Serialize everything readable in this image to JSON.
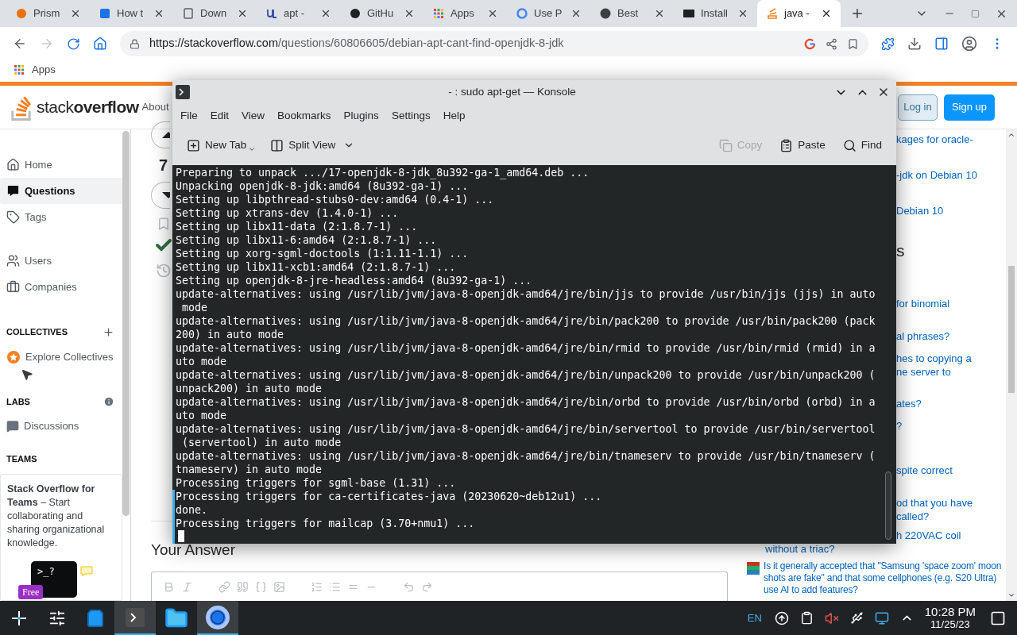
{
  "browser": {
    "tabs": [
      {
        "label": "Prism",
        "selected": false
      },
      {
        "label": "How t",
        "selected": false
      },
      {
        "label": "Down",
        "selected": false
      },
      {
        "label": "apt -",
        "selected": false
      },
      {
        "label": "GitHu",
        "selected": false
      },
      {
        "label": "Apps",
        "selected": false
      },
      {
        "label": "Use P",
        "selected": false
      },
      {
        "label": "Best",
        "selected": false
      },
      {
        "label": "Install",
        "selected": false
      },
      {
        "label": "java -",
        "selected": true
      }
    ],
    "url_host": "https://stackoverflow.com",
    "url_path": "/questions/60806605/debian-apt-cant-find-openjdk-8-jdk",
    "bookmarks": [
      "Apps"
    ]
  },
  "so": {
    "logo": "stack**overflow**",
    "nav": "About",
    "login": "Log in",
    "signup": "Sign up",
    "sidebar": {
      "sections": [
        {
          "items": [
            {
              "label": "Home",
              "selected": false
            },
            {
              "label": "Questions",
              "selected": true
            },
            {
              "label": "Tags",
              "selected": false
            }
          ]
        },
        {
          "items": [
            {
              "label": "Users",
              "selected": false
            },
            {
              "label": "Companies",
              "selected": false
            }
          ]
        }
      ],
      "collectives": {
        "heading": "COLLECTIVES",
        "item": "Explore Collectives"
      },
      "labs": {
        "heading": "LABS",
        "item": "Discussions"
      },
      "teams": {
        "heading": "TEAMS",
        "text": "**Stack Overflow for Teams** – Start collaborating and sharing organizational knowledge.",
        "glyph": ">_?",
        "badge": "Free"
      }
    },
    "main": {
      "vote_count": "7",
      "answer_heading": "Your Answer"
    },
    "right": {
      "items": [
        {
          "kind": "link",
          "lines": [
            "kages for oracle-"
          ]
        },
        {
          "kind": "link",
          "lines": [
            "-jdk on Debian 10"
          ]
        },
        {
          "kind": "link",
          "lines": [
            "Debian 10"
          ]
        },
        {
          "kind": "heading",
          "lines": [
            "s"
          ]
        },
        {
          "kind": "link",
          "lines": [
            "for binomial"
          ]
        },
        {
          "kind": "link",
          "lines": [
            "al phrases?"
          ]
        },
        {
          "kind": "link",
          "lines": [
            "hes to copying a",
            "ne server to"
          ]
        },
        {
          "kind": "link",
          "lines": [
            "ates?"
          ]
        },
        {
          "kind": "link",
          "lines": [
            "?"
          ]
        },
        {
          "kind": "link",
          "lines": [
            "spite correct"
          ]
        },
        {
          "kind": "link",
          "lines": [
            "od that you have",
            "called?"
          ]
        },
        {
          "kind": "link",
          "lines": [
            "h 220VAC coil"
          ]
        }
      ],
      "below": [
        {
          "kind": "link",
          "text": "without a triac?"
        },
        {
          "kind": "question",
          "text": "Is it generally accepted that \"Samsung 'space zoom' moon shots are fake\" and that some cellphones (e.g. S20 Ultra) use AI to add features?"
        }
      ]
    }
  },
  "konsole": {
    "title": "- : sudo apt-get — Konsole",
    "menu": [
      "File",
      "Edit",
      "View",
      "Bookmarks",
      "Plugins",
      "Settings",
      "Help"
    ],
    "toolbar": [
      {
        "label": "New Tab",
        "disabled": false
      },
      {
        "label": "Split View",
        "disabled": false
      },
      {
        "label": "Copy",
        "disabled": true
      },
      {
        "label": "Paste",
        "disabled": false
      },
      {
        "label": "Find",
        "disabled": false
      }
    ],
    "lines": [
      {
        "text": "Preparing to unpack .../17-openjdk-8-jdk_8u392-ga-1_amd64.deb ...",
        "marked": false
      },
      {
        "text": "Unpacking openjdk-8-jdk:amd64 (8u392-ga-1) ...",
        "marked": false
      },
      {
        "text": "Setting up libpthread-stubs0-dev:amd64 (0.4-1) ...",
        "marked": false
      },
      {
        "text": "Setting up xtrans-dev (1.4.0-1) ...",
        "marked": false
      },
      {
        "text": "Setting up libx11-data (2:1.8.7-1) ...",
        "marked": false
      },
      {
        "text": "Setting up libx11-6:amd64 (2:1.8.7-1) ...",
        "marked": false
      },
      {
        "text": "Setting up xorg-sgml-doctools (1:1.11-1.1) ...",
        "marked": false
      },
      {
        "text": "Setting up libx11-xcb1:amd64 (2:1.8.7-1) ...",
        "marked": false
      },
      {
        "text": "Setting up openjdk-8-jre-headless:amd64 (8u392-ga-1) ...",
        "marked": false
      },
      {
        "text": "update-alternatives: using /usr/lib/jvm/java-8-openjdk-amd64/jre/bin/jjs to provide /usr/bin/jjs (jjs) in auto",
        "marked": false
      },
      {
        "text": " mode",
        "marked": false
      },
      {
        "text": "update-alternatives: using /usr/lib/jvm/java-8-openjdk-amd64/jre/bin/pack200 to provide /usr/bin/pack200 (pack",
        "marked": false
      },
      {
        "text": "200) in auto mode",
        "marked": false
      },
      {
        "text": "update-alternatives: using /usr/lib/jvm/java-8-openjdk-amd64/jre/bin/rmid to provide /usr/bin/rmid (rmid) in a",
        "marked": false
      },
      {
        "text": "uto mode",
        "marked": false
      },
      {
        "text": "update-alternatives: using /usr/lib/jvm/java-8-openjdk-amd64/jre/bin/unpack200 to provide /usr/bin/unpack200 (",
        "marked": false
      },
      {
        "text": "unpack200) in auto mode",
        "marked": false
      },
      {
        "text": "update-alternatives: using /usr/lib/jvm/java-8-openjdk-amd64/jre/bin/orbd to provide /usr/bin/orbd (orbd) in a",
        "marked": false
      },
      {
        "text": "uto mode",
        "marked": false
      },
      {
        "text": "update-alternatives: using /usr/lib/jvm/java-8-openjdk-amd64/jre/bin/servertool to provide /usr/bin/servertool",
        "marked": false
      },
      {
        "text": " (servertool) in auto mode",
        "marked": false
      },
      {
        "text": "update-alternatives: using /usr/lib/jvm/java-8-openjdk-amd64/jre/bin/tnameserv to provide /usr/bin/tnameserv (",
        "marked": false
      },
      {
        "text": "tnameserv) in auto mode",
        "marked": false
      },
      {
        "text": "Processing triggers for sgml-base (1.31) ...",
        "marked": false
      },
      {
        "text": "Processing triggers for ca-certificates-java (20230620~deb12u1) ...",
        "marked": true
      },
      {
        "text": "done.",
        "marked": true
      },
      {
        "text": "Processing triggers for mailcap (3.70+nmu1) ...",
        "marked": true
      }
    ]
  },
  "taskbar": {
    "apps": [
      {
        "active": false
      },
      {
        "active": false
      },
      {
        "active": false
      },
      {
        "active": true
      },
      {
        "active": false
      },
      {
        "active": true
      }
    ],
    "language": "EN",
    "time": "10:28 PM",
    "date": "11/25/23"
  }
}
